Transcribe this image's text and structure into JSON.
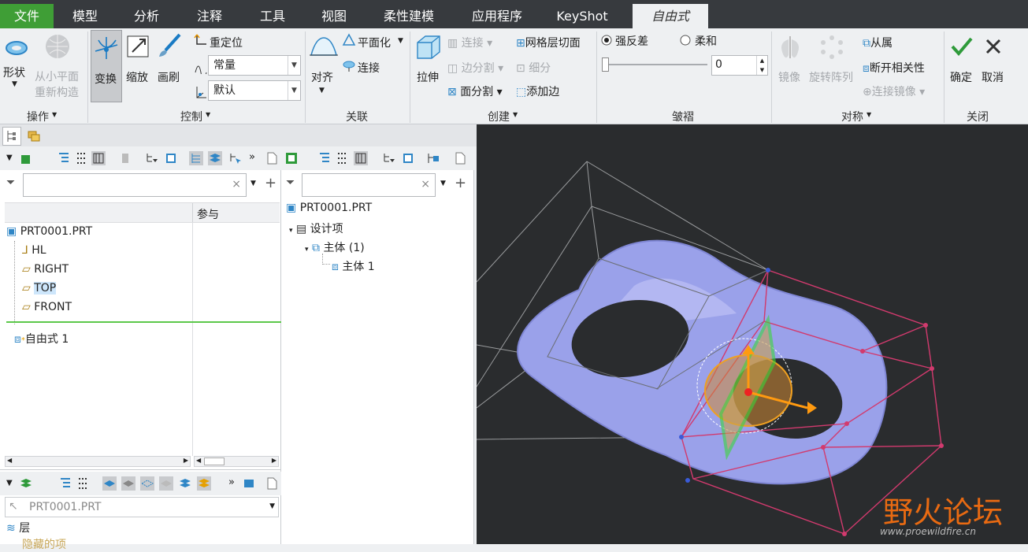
{
  "menu": {
    "tabs": [
      "文件",
      "模型",
      "分析",
      "注释",
      "工具",
      "视图",
      "柔性建模",
      "应用程序",
      "KeyShot",
      "自由式"
    ],
    "active_tab": "自由式"
  },
  "ribbon": {
    "operations": {
      "shape": "形状",
      "from_small_plane": "从小平面",
      "rebuild": "重新构造",
      "label": "操作"
    },
    "control": {
      "transform": "变换",
      "scale": "缩放",
      "brush": "画刷",
      "reposition": "重定位",
      "constant_value": "常量",
      "default_value": "默认",
      "label": "控制"
    },
    "assoc": {
      "align": "对齐",
      "planarize": "平面化",
      "connect": "连接",
      "label": "关联"
    },
    "create": {
      "extrude": "拉伸",
      "connect": "连接",
      "edge_split": "边分割",
      "face_split": "面分割",
      "mesh_cut": "网格层切面",
      "subdivide": "细分",
      "add_edge": "添加边",
      "label": "创建"
    },
    "crease": {
      "strong_crease": "强反差",
      "soft": "柔和",
      "value": "0",
      "label": "皱褶"
    },
    "symmetry": {
      "mirror": "镜像",
      "rotate_array": "旋转阵列",
      "slave": "从属",
      "break_assoc": "断开相关性",
      "connect_mirror": "连接镜像",
      "label": "对称"
    },
    "close": {
      "ok": "确定",
      "cancel": "取消",
      "label": "关闭"
    }
  },
  "left_panel": {
    "search_placeholder": "",
    "column_header": "参与",
    "root": "PRT0001.PRT",
    "items": [
      "HL",
      "RIGHT",
      "TOP",
      "FRONT"
    ],
    "feature": "自由式 1",
    "layer_combo": "PRT0001.PRT",
    "layer_root": "层",
    "hidden_items": "隐藏的项"
  },
  "mid_panel": {
    "root": "PRT0001.PRT",
    "design_items": "设计项",
    "body_group": "主体 (1)",
    "body": "主体 1"
  },
  "viewport": {
    "watermark": "野火论坛",
    "watermark_url": "www.proewildfire.cn"
  },
  "colors": {
    "accent_green": "#3f9e36",
    "menubar": "#373a3e",
    "viewport_bg": "#2a2c2e",
    "model": "#9aa1ea",
    "cage": "#d23a6e"
  }
}
